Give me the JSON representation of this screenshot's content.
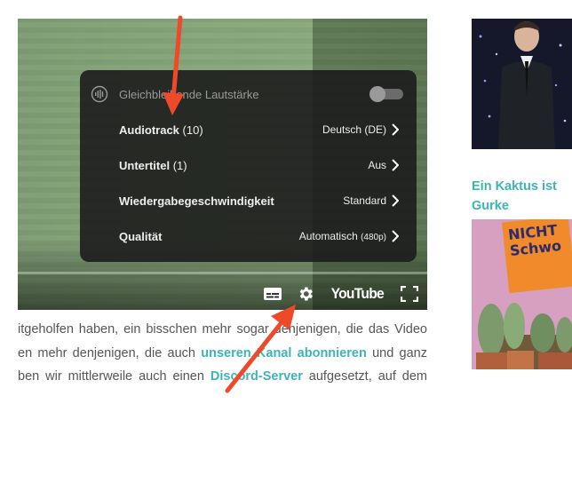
{
  "player": {
    "settings_menu": {
      "items": [
        {
          "label": "Gleichbleibende Lautstärke",
          "count": "",
          "value": "",
          "value_sub": "",
          "type": "toggle",
          "enabled": false
        },
        {
          "label": "Audiotrack",
          "count": "(10)",
          "value": "Deutsch (DE)",
          "value_sub": "",
          "type": "submenu"
        },
        {
          "label": "Untertitel",
          "count": "(1)",
          "value": "Aus",
          "value_sub": "",
          "type": "submenu"
        },
        {
          "label": "Wiedergabegeschwindigkeit",
          "count": "",
          "value": "Standard",
          "value_sub": "",
          "type": "submenu"
        },
        {
          "label": "Qualität",
          "count": "",
          "value": "Automatisch",
          "value_sub": "(480p)",
          "type": "submenu"
        }
      ]
    },
    "controls": {
      "subtitles_icon": "subtitles-icon",
      "settings_icon": "gear-icon",
      "youtube_logo": "YouTube",
      "fullscreen_icon": "fullscreen-icon"
    }
  },
  "article": {
    "line1": "itgeholfen haben, ein bisschen mehr sogar denjenigen, die das Video",
    "line2_pre": "en mehr denjenigen, die auch ",
    "line2_link": "unseren Kanal abonnieren",
    "line2_post": " und ganz",
    "line3_pre": "ben wir mittlerweile auch einen ",
    "line3_link": "Discord-Server",
    "line3_post": " aufgesetzt, auf dem"
  },
  "sidebar": {
    "article2_title_line1": "Ein Kaktus ist",
    "article2_title_line2": "Gurke",
    "thumb2_sign_line1": "NICHT",
    "thumb2_sign_line2": "Schwo"
  },
  "colors": {
    "link": "#3eb3b8",
    "annotation_arrow": "#ee4a2a",
    "menu_bg": "#1c1c1c"
  }
}
